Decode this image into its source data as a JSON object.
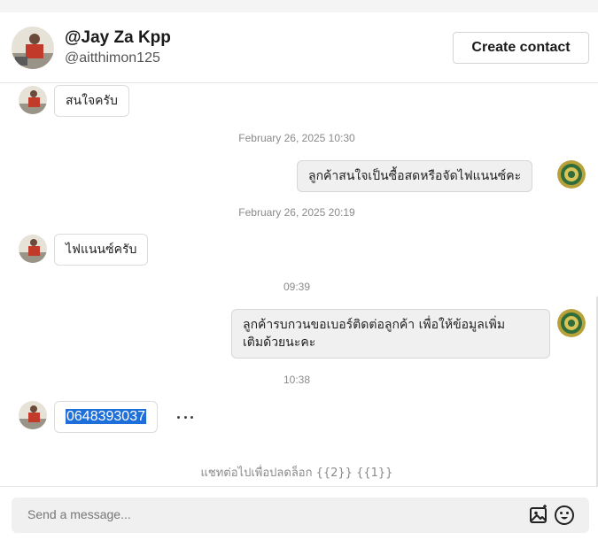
{
  "header": {
    "name": "@Jay Za Kpp",
    "handle": "@aitthimon125",
    "create_contact_label": "Create contact"
  },
  "messages": {
    "m1": "สนใจครับ",
    "ts1": "February 26, 2025 10:30",
    "m2": "ลูกค้าสนใจเป็นซื้อสดหรือจัดไฟแนนซ์คะ",
    "ts2": "February 26, 2025 20:19",
    "m3": "ไฟแนนซ์ครับ",
    "ts3": "09:39",
    "m4_line1": "ลูกค้ารบกวนขอเบอร์ติดต่อลูกค้า เพื่อให้ข้อมูลเพิ่ม",
    "m4_line2": "เติมด้วยนะคะ",
    "ts4": "10:38",
    "m5": "0648393037"
  },
  "unlock_notice": "แชทต่อไปเพื่อปลดล็อก {{2}} {{1}}",
  "composer": {
    "placeholder": "Send a message..."
  },
  "icons": {
    "image": "image-icon",
    "emoji": "emoji-icon",
    "more": "more-options-icon"
  },
  "colors": {
    "selection": "#1e6fd9",
    "agent_avatar": "#b8a13a"
  }
}
